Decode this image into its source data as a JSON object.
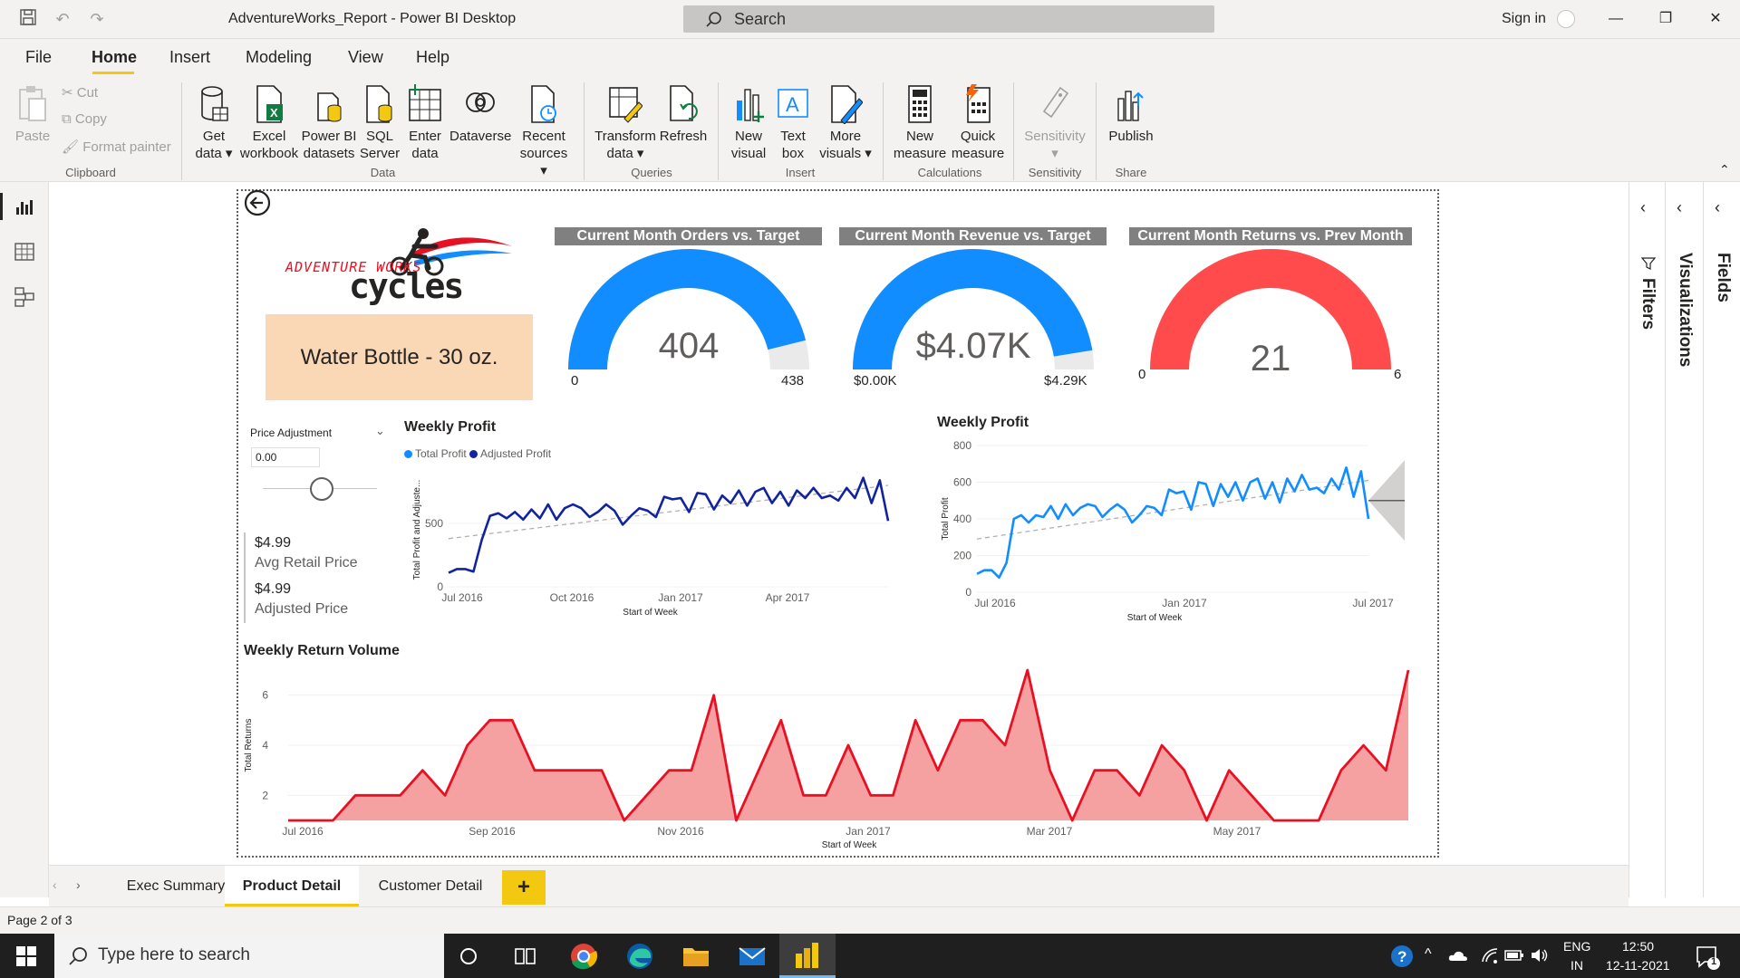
{
  "window": {
    "title": "AdventureWorks_Report - Power BI Desktop",
    "search_label": "Search",
    "signin": "Sign in"
  },
  "menu": {
    "items": [
      "File",
      "Home",
      "Insert",
      "Modeling",
      "View",
      "Help"
    ],
    "active": "Home"
  },
  "ribbon": {
    "clipboard": {
      "paste": "Paste",
      "cut": "Cut",
      "copy": "Copy",
      "format_painter": "Format painter",
      "group": "Clipboard"
    },
    "data": {
      "get_data": "Get data",
      "excel": "Excel workbook",
      "pbi_datasets": "Power BI datasets",
      "sql": "SQL Server",
      "enter": "Enter data",
      "dataverse": "Dataverse",
      "recent": "Recent sources",
      "group": "Data"
    },
    "queries": {
      "transform": "Transform data",
      "refresh": "Refresh",
      "group": "Queries"
    },
    "insert": {
      "new_visual": "New visual",
      "text_box": "Text box",
      "more_visuals": "More visuals",
      "group": "Insert"
    },
    "calculations": {
      "new_measure": "New measure",
      "quick_measure": "Quick measure",
      "group": "Calculations"
    },
    "sensitivity": {
      "label": "Sensitivity",
      "group": "Sensitivity"
    },
    "share": {
      "publish": "Publish",
      "group": "Share"
    }
  },
  "panes": {
    "filters": "Filters",
    "visualizations": "Visualizations",
    "fields": "Fields"
  },
  "report": {
    "logo_line1": "ADVENTURE WORKS",
    "logo_line2": "cycles",
    "product_name": "Water Bottle - 30 oz.",
    "gauges": [
      {
        "title": "Current Month Orders vs. Target",
        "value": "404",
        "min": "0",
        "max": "438",
        "fraction": 0.922,
        "color": "#118dff"
      },
      {
        "title": "Current Month Revenue vs. Target",
        "value": "$4.07K",
        "min": "$0.00K",
        "max": "$4.29K",
        "fraction": 0.949,
        "color": "#118dff"
      },
      {
        "title": "Current Month Returns vs. Prev Month",
        "value": "21",
        "min": "0",
        "max": "6",
        "fraction": 1.0,
        "color": "#ff4b4b"
      }
    ],
    "slicer": {
      "title": "Price Adjustment",
      "value": "0.00"
    },
    "cards": [
      {
        "value": "$4.99",
        "label": "Avg Retail Price"
      },
      {
        "value": "$4.99",
        "label": "Adjusted Price"
      }
    ]
  },
  "tabs": {
    "items": [
      "Exec Summary",
      "Product Detail",
      "Customer Detail"
    ],
    "active": "Product Detail",
    "add": "+"
  },
  "status": {
    "page": "Page 2 of 3"
  },
  "taskbar": {
    "search": "Type here to search",
    "lang1": "ENG",
    "lang2": "IN",
    "time": "12:50",
    "date": "12-11-2021",
    "notif": "1"
  },
  "colors": {
    "accent": "#f2c811",
    "blue": "#118dff",
    "navy": "#12239e",
    "red": "#e81123",
    "area_fill": "#f6a1a1"
  },
  "chart_data": [
    {
      "type": "line",
      "title": "Weekly Profit",
      "legend": [
        "Total Profit",
        "Adjusted Profit"
      ],
      "xlabel": "Start of Week",
      "ylabel": "Total Profit and Adjuste...",
      "x_ticks": [
        "Jul 2016",
        "Oct 2016",
        "Jan 2017",
        "Apr 2017"
      ],
      "y_ticks": [
        "0",
        "500"
      ],
      "ylim": [
        0,
        900
      ],
      "series": [
        {
          "name": "Adjusted Profit",
          "values": [
            110,
            140,
            140,
            120,
            370,
            560,
            580,
            540,
            590,
            530,
            610,
            540,
            650,
            530,
            620,
            650,
            620,
            550,
            590,
            650,
            600,
            490,
            560,
            620,
            600,
            550,
            710,
            690,
            700,
            590,
            740,
            730,
            610,
            720,
            660,
            760,
            640,
            750,
            780,
            660,
            750,
            640,
            760,
            700,
            780,
            700,
            720,
            680,
            780,
            700,
            860,
            660,
            840,
            520
          ]
        },
        {
          "name": "Total Profit",
          "values": []
        }
      ],
      "trend": [
        380,
        800
      ]
    },
    {
      "type": "line",
      "title": "Weekly Profit",
      "xlabel": "Start of Week",
      "ylabel": "Total Profit",
      "x_ticks": [
        "Jul 2016",
        "Jan 2017",
        "Jul 2017"
      ],
      "y_ticks": [
        "0",
        "200",
        "400",
        "600",
        "800"
      ],
      "ylim": [
        0,
        800
      ],
      "series": [
        {
          "name": "Total Profit",
          "values": [
            100,
            120,
            120,
            80,
            160,
            400,
            420,
            380,
            420,
            410,
            470,
            400,
            480,
            420,
            460,
            480,
            470,
            410,
            450,
            480,
            450,
            380,
            420,
            470,
            460,
            420,
            560,
            540,
            550,
            450,
            600,
            590,
            470,
            590,
            520,
            600,
            500,
            600,
            620,
            510,
            600,
            490,
            620,
            550,
            640,
            560,
            570,
            540,
            620,
            560,
            680,
            520,
            660,
            400
          ]
        }
      ],
      "trend": [
        290,
        610
      ],
      "forecast": {
        "value": 500,
        "upper": 720,
        "lower": 280
      }
    },
    {
      "type": "area",
      "title": "Weekly Return Volume",
      "xlabel": "Start of Week",
      "ylabel": "Total Returns",
      "x_ticks": [
        "Jul 2016",
        "Sep 2016",
        "Nov 2016",
        "Jan 2017",
        "Mar 2017",
        "May 2017"
      ],
      "y_ticks": [
        "2",
        "4",
        "6"
      ],
      "ylim": [
        1,
        7
      ],
      "series": [
        {
          "name": "Total Returns",
          "values": [
            1,
            1,
            1,
            2,
            2,
            2,
            3,
            2,
            4,
            5,
            5,
            3,
            3,
            3,
            3,
            1,
            2,
            3,
            3,
            6,
            1,
            3,
            5,
            2,
            2,
            4,
            2,
            2,
            5,
            3,
            5,
            5,
            4,
            7,
            3,
            1,
            3,
            3,
            2,
            4,
            3,
            1,
            3,
            2,
            1,
            1,
            1,
            3,
            4,
            3,
            7
          ]
        }
      ]
    }
  ]
}
